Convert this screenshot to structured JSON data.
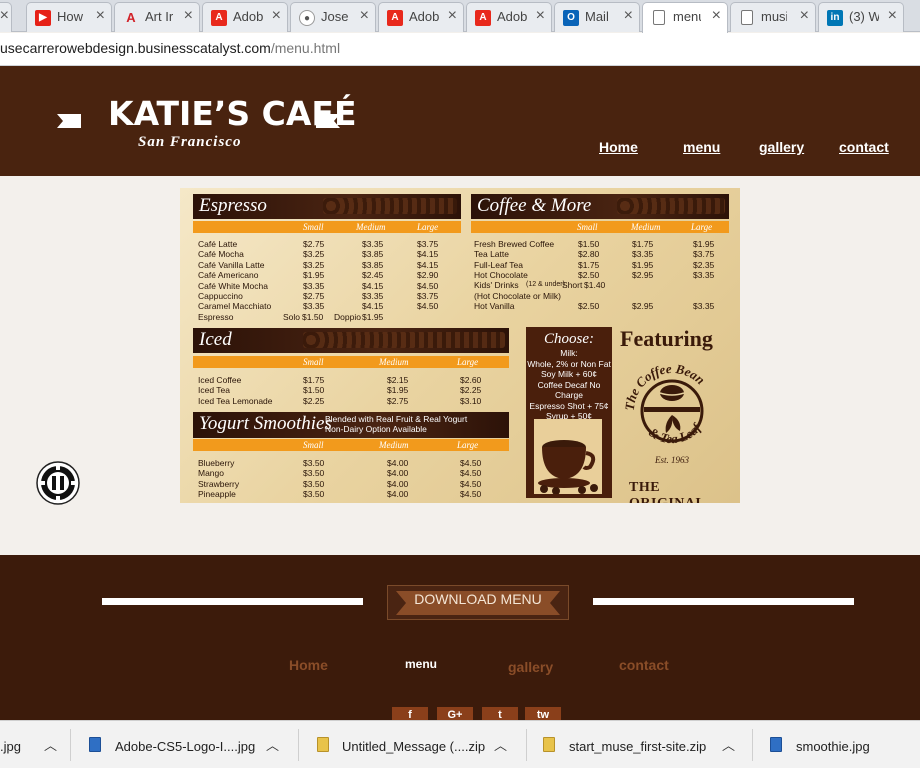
{
  "browser": {
    "tabs": [
      {
        "title": "How",
        "icon": "youtube-icon",
        "color": "#e62117"
      },
      {
        "title": "Art Ir",
        "icon": "adobe-art-icon",
        "color": "#d2232a"
      },
      {
        "title": "Adob",
        "icon": "adobe-icon",
        "color": "#e8291c"
      },
      {
        "title": "Jose",
        "icon": "eye-icon",
        "color": "#555555"
      },
      {
        "title": "Adob",
        "icon": "adobe-icon",
        "color": "#e8291c"
      },
      {
        "title": "Adob",
        "icon": "adobe-icon",
        "color": "#e8291c"
      },
      {
        "title": "Mail",
        "icon": "outlook-icon",
        "color": "#0a64b8"
      },
      {
        "title": "menu",
        "icon": "page-icon",
        "color": "#777777"
      },
      {
        "title": "musi",
        "icon": "page-icon",
        "color": "#777777"
      },
      {
        "title": "(3) W",
        "icon": "linkedin-icon",
        "color": "#0077b5"
      }
    ],
    "url_host": "usecarrerowebdesign.businesscatalyst.com",
    "url_path": "/menu.html"
  },
  "header": {
    "title": "KATIE’S CAFÉ",
    "subtitle": "San Francisco",
    "nav": [
      "Home",
      "menu",
      "gallery",
      "contact"
    ],
    "bg_color": "#49230f"
  },
  "menu": {
    "espresso": {
      "title": "Espresso",
      "sizes": [
        "Small",
        "Medium",
        "Large"
      ],
      "rows": [
        [
          "Café Latte",
          "$2.75",
          "$3.35",
          "$3.75"
        ],
        [
          "Café Mocha",
          "$3.25",
          "$3.85",
          "$4.15"
        ],
        [
          "Café Vanilla Latte",
          "$3.25",
          "$3.85",
          "$4.15"
        ],
        [
          "Café Americano",
          "$1.95",
          "$2.45",
          "$2.90"
        ],
        [
          "Café White Mocha",
          "$3.35",
          "$4.15",
          "$4.50"
        ],
        [
          "Cappuccino",
          "$2.75",
          "$3.35",
          "$3.75"
        ],
        [
          "Caramel Macchiato",
          "$3.35",
          "$4.15",
          "$4.50"
        ]
      ],
      "espresso_row": {
        "name": "Espresso",
        "solo_label": "Solo",
        "solo_price": "$1.50",
        "doppio_label": "Doppio",
        "doppio_price": "$1.95"
      }
    },
    "coffee": {
      "title": "Coffee & More",
      "sizes": [
        "Small",
        "Medium",
        "Large"
      ],
      "rows": [
        [
          "Fresh Brewed Coffee",
          "$1.50",
          "$1.75",
          "$1.95"
        ],
        [
          "Tea Latte",
          "$2.80",
          "$3.35",
          "$3.75"
        ],
        [
          "Full-Leaf Tea",
          "$1.75",
          "$1.95",
          "$2.35"
        ],
        [
          "Hot Chocolate",
          "$2.50",
          "$2.95",
          "$3.35"
        ]
      ],
      "kids_line1": "Kids' Drinks",
      "kids_note": "(12 & under)",
      "kids_short": "Short",
      "kids_price": "$1.40",
      "kids_line2": "(Hot Chocolate or Milk)",
      "hot_vanilla": [
        "Hot Vanilla",
        "$2.50",
        "$2.95",
        "$3.35"
      ]
    },
    "iced": {
      "title": "Iced",
      "sizes": [
        "Small",
        "Medium",
        "Large"
      ],
      "rows": [
        [
          "Iced Coffee",
          "$1.75",
          "$2.15",
          "$2.60"
        ],
        [
          "Iced Tea",
          "$1.50",
          "$1.95",
          "$2.25"
        ],
        [
          "Iced Tea Lemonade",
          "$2.25",
          "$2.75",
          "$3.10"
        ]
      ]
    },
    "smoothies": {
      "title": "Yogurt Smoothies",
      "blurb1": "Blended with Real Fruit & Real Yogurt",
      "blurb2": "Non-Dairy Option Available",
      "sizes": [
        "Small",
        "Medium",
        "Large"
      ],
      "rows": [
        [
          "Blueberry",
          "$3.50",
          "$4.00",
          "$4.50"
        ],
        [
          "Mango",
          "$3.50",
          "$4.00",
          "$4.50"
        ],
        [
          "Strawberry",
          "$3.50",
          "$4.00",
          "$4.50"
        ],
        [
          "Pineapple",
          "$3.50",
          "$4.00",
          "$4.50"
        ]
      ]
    },
    "choose": {
      "title": "Choose:",
      "lines": [
        "Milk:",
        "Whole, 2% or Non Fat",
        "Soy Milk + 60¢",
        "Coffee Decaf No Charge",
        "Espresso Shot + 75¢",
        "Syrup + 50¢"
      ]
    },
    "featuring": "Featuring",
    "brand_top": "The Coffee Bean",
    "brand_bottom": "& Tea Leaf",
    "brand_est": "Est. 1963",
    "the_original": "THE ORIGINAL"
  },
  "footer": {
    "download_label": "DOWNLOAD MENU",
    "nav": [
      "Home",
      "menu",
      "gallery",
      "contact"
    ],
    "social": [
      "f",
      "G+",
      "t",
      "tw"
    ],
    "bg_color": "#3c1b0b"
  },
  "downloads": [
    {
      "name": ".jpg",
      "icon": "image-file-icon"
    },
    {
      "name": "Adobe-CS5-Logo-I....jpg",
      "icon": "image-file-icon"
    },
    {
      "name": "Untitled_Message (....zip",
      "icon": "zip-file-icon"
    },
    {
      "name": "start_muse_first-site.zip",
      "icon": "zip-file-icon"
    },
    {
      "name": "smoothie.jpg",
      "icon": "image-file-icon"
    }
  ]
}
